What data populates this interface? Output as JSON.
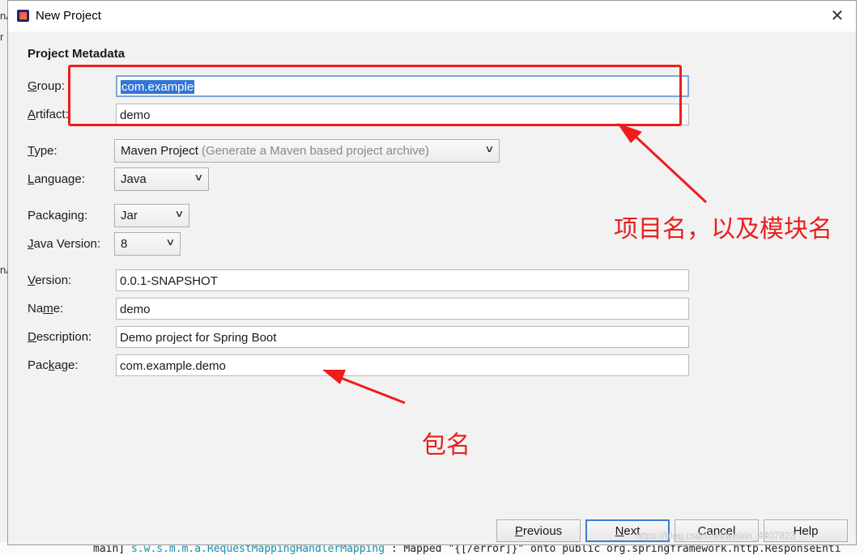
{
  "ide": {
    "left_fragments": [
      "nA",
      "r",
      "nA"
    ],
    "console_prefix": "main]",
    "console_logger": "s.w.s.m.m.a.RequestMappingHandlerMapping",
    "console_msg": " : Mapped \"{[/error]}\" onto public org.springframework.http.ResponseEnti"
  },
  "dialog": {
    "title": "New Project",
    "close_glyph": "✕",
    "section_title": "Project Metadata"
  },
  "form": {
    "group": {
      "label_pre": "",
      "label_u": "G",
      "label_post": "roup:",
      "value": "com.example"
    },
    "artifact": {
      "label_pre": "",
      "label_u": "A",
      "label_post": "rtifact:",
      "value": "demo"
    },
    "type": {
      "label_pre": "",
      "label_u": "T",
      "label_post": "ype:",
      "value": "Maven Project",
      "hint": "(Generate a Maven based project archive)"
    },
    "language": {
      "label_pre": "",
      "label_u": "L",
      "label_post": "anguage:",
      "value": "Java"
    },
    "packaging": {
      "label_pre": "Packa",
      "label_u": "g",
      "label_post": "ing:",
      "value": "Jar"
    },
    "java_version": {
      "label_pre": "",
      "label_u": "J",
      "label_post": "ava Version:",
      "value": "8"
    },
    "version": {
      "label_pre": "",
      "label_u": "V",
      "label_post": "ersion:",
      "value": "0.0.1-SNAPSHOT"
    },
    "name": {
      "label_pre": "Na",
      "label_u": "m",
      "label_post": "e:",
      "value": "demo"
    },
    "description": {
      "label_pre": "",
      "label_u": "D",
      "label_post": "escription:",
      "value": "Demo project for Spring Boot"
    },
    "package": {
      "label_pre": "Pac",
      "label_u": "k",
      "label_post": "age:",
      "value": "com.example.demo"
    }
  },
  "buttons": {
    "previous": {
      "u": "P",
      "rest": "revious"
    },
    "next": {
      "u": "N",
      "rest": "ext"
    },
    "cancel": "Cancel",
    "help": "Help"
  },
  "annotations": {
    "project_name_note": "项目名，以及模块名",
    "package_note": "包名",
    "color": "#e8201f"
  },
  "watermark": "https://blog.csdn.net/weixin_4407823"
}
